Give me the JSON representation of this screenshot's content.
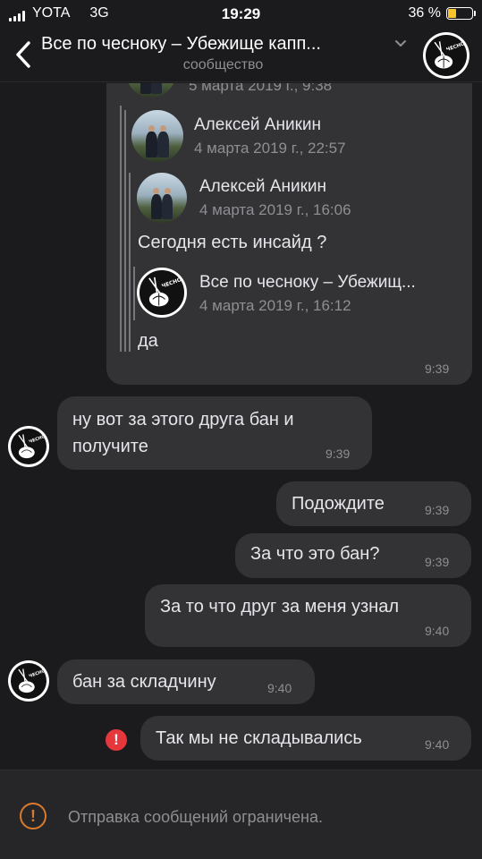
{
  "status_bar": {
    "carrier": "YOTA",
    "network": "3G",
    "time": "19:29",
    "battery_percent": "36 %",
    "battery_level": 0.36,
    "battery_color": "#f7c52b"
  },
  "header": {
    "title": "Все по чесноку – Убежище капп...",
    "subtitle": "сообщество",
    "back_icon": "chevron-left-icon",
    "menu_icon": "chevron-down-icon"
  },
  "logo_text": "ЧЕСНОКУ",
  "forwarded": {
    "top_date": "5 марта 2019 г., 9:38",
    "items": [
      {
        "name": "Алексей Аникин",
        "date": "4 марта 2019 г., 22:57"
      },
      {
        "name": "Алексей Аникин",
        "date": "4 марта 2019 г., 16:06",
        "text": "Сегодня есть инсайд ?"
      },
      {
        "name": "Все по чесноку – Убежищ...",
        "date": "4 марта 2019 г., 16:12",
        "text": "да"
      }
    ],
    "time": "9:39"
  },
  "messages": [
    {
      "text_lines": [
        "ну вот за этого друга бан и",
        "получите"
      ],
      "time": "9:39"
    },
    {
      "text": "Подождите",
      "time": "9:39"
    },
    {
      "text": "За что это бан?",
      "time": "9:39"
    },
    {
      "text": "За то что друг за меня узнал",
      "time": "9:40"
    },
    {
      "text": "бан за складчину",
      "time": "9:40"
    },
    {
      "text": "Так мы не складывались",
      "time": "9:40",
      "error_icon": "!"
    }
  ],
  "footer": {
    "warning_icon": "!",
    "text": "Отправка сообщений ограничена."
  }
}
